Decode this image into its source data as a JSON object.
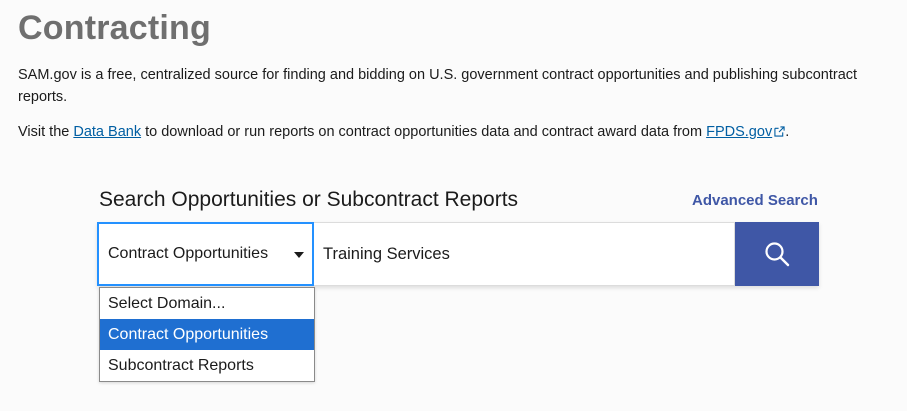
{
  "page": {
    "title": "Contracting",
    "intro": "SAM.gov is a free, centralized source for finding and bidding on U.S. government contract opportunities and publishing subcontract reports.",
    "visit_prefix": "Visit the ",
    "data_bank_link": "Data Bank",
    "visit_middle": " to download or run reports on contract opportunities data and contract award data from ",
    "fpds_link": "FPDS.gov",
    "visit_suffix": "."
  },
  "search": {
    "heading": "Search Opportunities or Subcontract Reports",
    "advanced_link": "Advanced Search",
    "domain_selected": "Contract Opportunities",
    "query": "Training Services",
    "button_icon": "search-icon",
    "domain_options": [
      {
        "label": "Select Domain..."
      },
      {
        "label": "Contract Opportunities"
      },
      {
        "label": "Subcontract Reports"
      }
    ]
  },
  "colors": {
    "title_gray": "#6f6f6f",
    "link_blue": "#005ea2",
    "brand_indigo": "#3f57a6",
    "focus_blue": "#2491ff",
    "option_highlight": "#1f6fd1"
  }
}
